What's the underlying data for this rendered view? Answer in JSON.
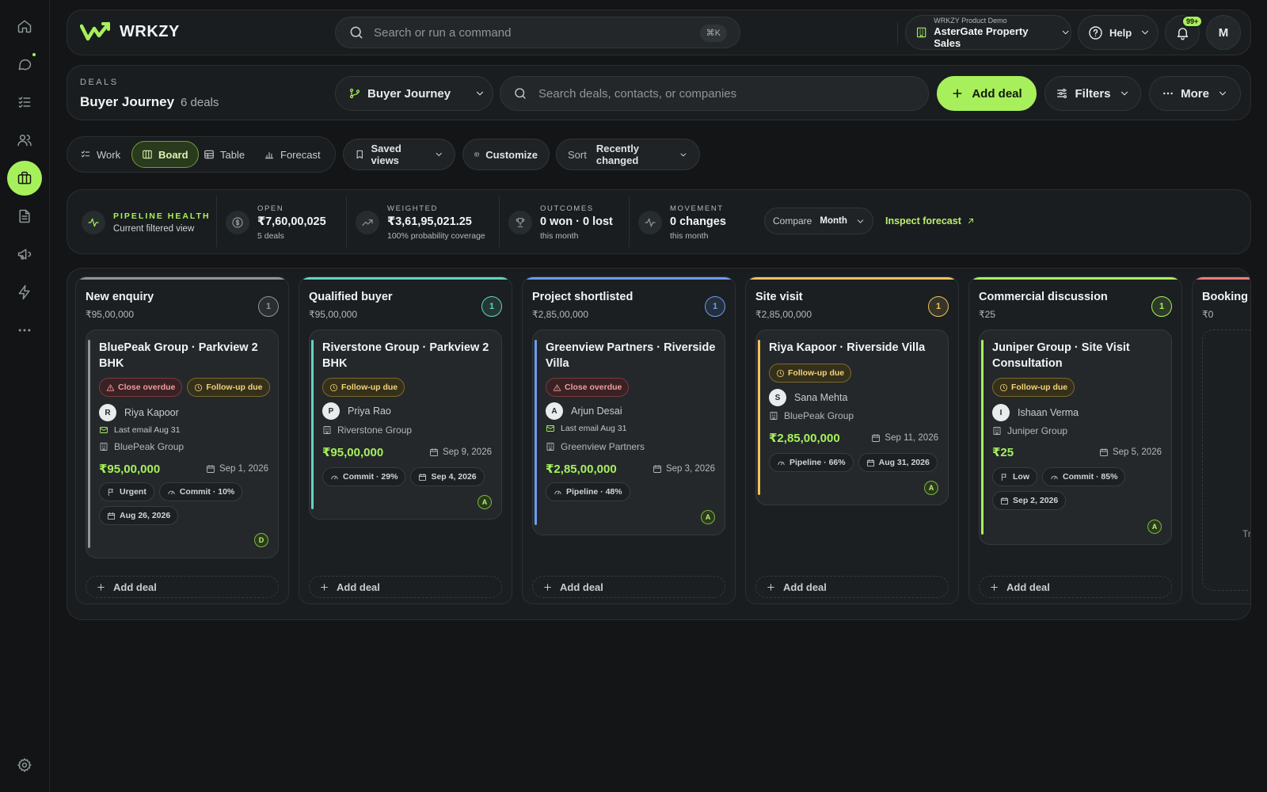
{
  "rail": {
    "items": [
      {
        "icon": "home-icon"
      },
      {
        "icon": "chat-icon",
        "unread": true
      },
      {
        "icon": "tasks-icon"
      },
      {
        "icon": "contacts-icon"
      },
      {
        "icon": "briefcase-icon",
        "active": true
      },
      {
        "icon": "document-icon"
      },
      {
        "icon": "megaphone-icon"
      },
      {
        "icon": "lightning-icon"
      },
      {
        "icon": "more-icon"
      }
    ],
    "settings_icon": "gear-icon"
  },
  "topbar": {
    "brand": "WRKZY",
    "search_placeholder": "Search or run a command",
    "shortcut": "⌘K",
    "workspace_caption": "WRKZY Product Demo",
    "workspace_name": "AsterGate Property Sales",
    "help_label": "Help",
    "notifications_badge": "99+",
    "user_initial": "M"
  },
  "header": {
    "eyebrow": "DEALS",
    "title": "Buyer Journey",
    "count": "6 deals",
    "pipeline_select": "Buyer Journey",
    "search_placeholder": "Search deals, contacts, or companies",
    "add_deal": "Add deal",
    "filters": "Filters",
    "more": "More"
  },
  "views": {
    "tabs": [
      "Work",
      "Board",
      "Table",
      "Forecast"
    ],
    "active": "Board",
    "saved_views": "Saved views",
    "customize": "Customize",
    "sort_label": "Sort",
    "sort_value": "Recently changed"
  },
  "health": {
    "title": "PIPELINE HEALTH",
    "subtitle": "Current filtered view",
    "open": {
      "label": "OPEN",
      "value": "₹7,60,00,025",
      "sub": "5 deals"
    },
    "weighted": {
      "label": "WEIGHTED",
      "value": "₹3,61,95,021.25",
      "sub": "100% probability coverage"
    },
    "outcomes": {
      "label": "OUTCOMES",
      "value": "0 won · 0 lost",
      "sub": "this month"
    },
    "movement": {
      "label": "MOVEMENT",
      "value": "0 changes",
      "sub": "this month"
    },
    "compare_label": "Compare",
    "compare_value": "Month",
    "inspect": "Inspect forecast"
  },
  "board": {
    "add_label": "Add deal",
    "columns": [
      {
        "name": "New enquiry",
        "value": "₹95,00,000",
        "count": "1",
        "color": "#8e9699",
        "card": {
          "title": "BluePeak Group · Parkview 2 BHK",
          "tags": [
            {
              "text": "Close overdue",
              "kind": "red"
            },
            {
              "text": "Follow-up due",
              "kind": "amber"
            }
          ],
          "contact_initial": "R",
          "contact": "Riya Kapoor",
          "last_email": "Last email Aug 31",
          "company": "BluePeak Group",
          "amount": "₹95,00,000",
          "close_date": "Sep 1, 2026",
          "chips": [
            {
              "icon": "flag-icon",
              "text": "Urgent"
            },
            {
              "icon": "gauge-icon",
              "text": "Commit · 10%"
            },
            {
              "icon": "calendar-icon",
              "text": "Aug 26, 2026"
            }
          ],
          "owner": "D"
        }
      },
      {
        "name": "Qualified buyer",
        "value": "₹95,00,000",
        "count": "1",
        "color": "#5fd6c0",
        "card": {
          "title": "Riverstone Group · Parkview 2 BHK",
          "tags": [
            {
              "text": "Follow-up due",
              "kind": "amber"
            }
          ],
          "contact_initial": "P",
          "contact": "Priya Rao",
          "company": "Riverstone Group",
          "amount": "₹95,00,000",
          "close_date": "Sep 9, 2026",
          "chips": [
            {
              "icon": "gauge-icon",
              "text": "Commit · 29%"
            },
            {
              "icon": "calendar-icon",
              "text": "Sep 4, 2026"
            }
          ],
          "owner": "A"
        }
      },
      {
        "name": "Project shortlisted",
        "value": "₹2,85,00,000",
        "count": "1",
        "color": "#6b9cf2",
        "card": {
          "title": "Greenview Partners · Riverside Villa",
          "tags": [
            {
              "text": "Close overdue",
              "kind": "red"
            }
          ],
          "contact_initial": "A",
          "contact": "Arjun Desai",
          "last_email": "Last email Aug 31",
          "company": "Greenview Partners",
          "amount": "₹2,85,00,000",
          "close_date": "Sep 3, 2026",
          "chips": [
            {
              "icon": "gauge-icon",
              "text": "Pipeline · 48%"
            }
          ],
          "owner": "A"
        }
      },
      {
        "name": "Site visit",
        "value": "₹2,85,00,000",
        "count": "1",
        "color": "#f2c25e",
        "card": {
          "title": "Riya Kapoor · Riverside Villa",
          "tags": [
            {
              "text": "Follow-up due",
              "kind": "amber"
            }
          ],
          "contact_initial": "S",
          "contact": "Sana Mehta",
          "company": "BluePeak Group",
          "amount": "₹2,85,00,000",
          "close_date": "Sep 11, 2026",
          "chips": [
            {
              "icon": "gauge-icon",
              "text": "Pipeline · 66%"
            },
            {
              "icon": "calendar-icon",
              "text": "Aug 31, 2026"
            }
          ],
          "owner": "A"
        }
      },
      {
        "name": "Commercial discussion",
        "value": "₹25",
        "count": "1",
        "color": "#a7f05b",
        "card": {
          "title": "Juniper Group · Site Visit Consultation",
          "tags": [
            {
              "text": "Follow-up due",
              "kind": "amber"
            }
          ],
          "contact_initial": "I",
          "contact": "Ishaan Verma",
          "company": "Juniper Group",
          "amount": "₹25",
          "close_date": "Sep 5, 2026",
          "chips": [
            {
              "icon": "flag-icon",
              "text": "Low"
            },
            {
              "icon": "gauge-icon",
              "text": "Commit · 85%"
            },
            {
              "icon": "calendar-icon",
              "text": "Sep 2, 2026"
            }
          ],
          "owner": "A"
        }
      },
      {
        "name": "Booking",
        "value": "₹0",
        "count": "",
        "color": "#f07a7a",
        "empty_text": "Tr"
      }
    ]
  }
}
